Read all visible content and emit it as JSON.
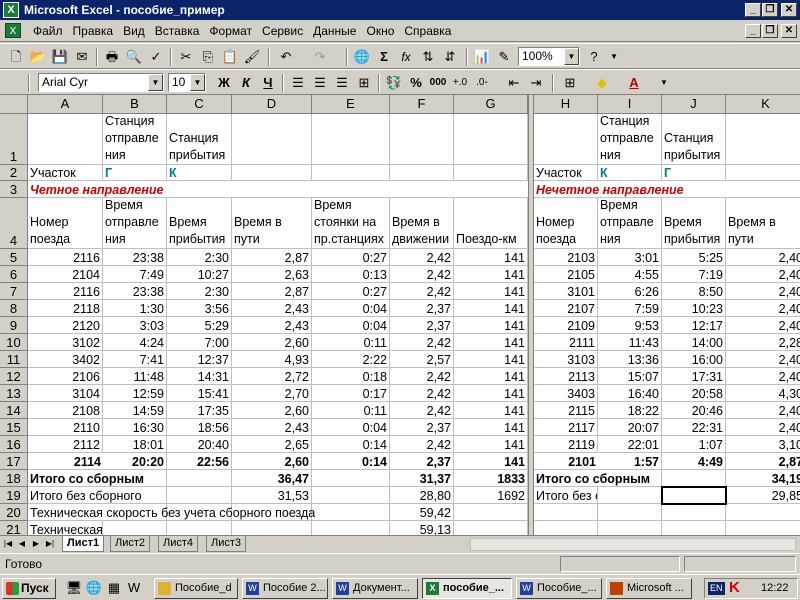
{
  "window": {
    "title": "Microsoft Excel - пособие_пример",
    "app_icon": "excel-icon"
  },
  "menu": [
    "Файл",
    "Правка",
    "Вид",
    "Вставка",
    "Формат",
    "Сервис",
    "Данные",
    "Окно",
    "Справка"
  ],
  "toolbar": {
    "zoom": "100%",
    "font_name": "Arial Cyr",
    "font_size": "10",
    "bold": "Ж",
    "italic": "К",
    "underline": "Ч",
    "percent": "%",
    "thousands": "000",
    "sigma": "Σ",
    "fx": "fx"
  },
  "columns": [
    "A",
    "B",
    "C",
    "D",
    "E",
    "F",
    "G",
    "H",
    "I",
    "J",
    "K"
  ],
  "rows": {
    "r1": {
      "n": "1",
      "B": "Станция отправле ния",
      "C": "Станция прибытия",
      "I": "Станция отправле ния",
      "J": "Станция прибытия"
    },
    "r2": {
      "n": "2",
      "A": "Участок",
      "B": "Г",
      "C": "К",
      "H": "Участок",
      "I": "К",
      "J": "Г"
    },
    "r3": {
      "n": "3",
      "A": "Четное направление",
      "H": "Нечетное направление"
    },
    "r4": {
      "n": "4",
      "A": "Номер поезда",
      "B": "Время отправле ния",
      "C": "Время прибытия",
      "D": "Время в пути",
      "E": "Время стоянки на пр.станциях",
      "F": "Время в движении",
      "G": "Поездо-км",
      "H": "Номер поезда",
      "I": "Время отправле ния",
      "J": "Время прибытия",
      "K": "Время в пути"
    }
  },
  "data_rows": [
    {
      "n": "5",
      "A": "2116",
      "B": "23:38",
      "C": "2:30",
      "D": "2,87",
      "E": "0:27",
      "F": "2,42",
      "G": "141",
      "H": "2103",
      "I": "3:01",
      "J": "5:25",
      "K": "2,40"
    },
    {
      "n": "6",
      "A": "2104",
      "B": "7:49",
      "C": "10:27",
      "D": "2,63",
      "E": "0:13",
      "F": "2,42",
      "G": "141",
      "H": "2105",
      "I": "4:55",
      "J": "7:19",
      "K": "2,40"
    },
    {
      "n": "7",
      "A": "2116",
      "B": "23:38",
      "C": "2:30",
      "D": "2,87",
      "E": "0:27",
      "F": "2,42",
      "G": "141",
      "H": "3101",
      "I": "6:26",
      "J": "8:50",
      "K": "2,40"
    },
    {
      "n": "8",
      "A": "2118",
      "B": "1:30",
      "C": "3:56",
      "D": "2,43",
      "E": "0:04",
      "F": "2,37",
      "G": "141",
      "H": "2107",
      "I": "7:59",
      "J": "10:23",
      "K": "2,40"
    },
    {
      "n": "9",
      "A": "2120",
      "B": "3:03",
      "C": "5:29",
      "D": "2,43",
      "E": "0:04",
      "F": "2,37",
      "G": "141",
      "H": "2109",
      "I": "9:53",
      "J": "12:17",
      "K": "2,40"
    },
    {
      "n": "10",
      "A": "3102",
      "B": "4:24",
      "C": "7:00",
      "D": "2,60",
      "E": "0:11",
      "F": "2,42",
      "G": "141",
      "H": "2111",
      "I": "11:43",
      "J": "14:00",
      "K": "2,28"
    },
    {
      "n": "11",
      "A": "3402",
      "B": "7:41",
      "C": "12:37",
      "D": "4,93",
      "E": "2:22",
      "F": "2,57",
      "G": "141",
      "H": "3103",
      "I": "13:36",
      "J": "16:00",
      "K": "2,40"
    },
    {
      "n": "12",
      "A": "2106",
      "B": "11:48",
      "C": "14:31",
      "D": "2,72",
      "E": "0:18",
      "F": "2,42",
      "G": "141",
      "H": "2113",
      "I": "15:07",
      "J": "17:31",
      "K": "2,40"
    },
    {
      "n": "13",
      "A": "3104",
      "B": "12:59",
      "C": "15:41",
      "D": "2,70",
      "E": "0:17",
      "F": "2,42",
      "G": "141",
      "H": "3403",
      "I": "16:40",
      "J": "20:58",
      "K": "4,30"
    },
    {
      "n": "14",
      "A": "2108",
      "B": "14:59",
      "C": "17:35",
      "D": "2,60",
      "E": "0:11",
      "F": "2,42",
      "G": "141",
      "H": "2115",
      "I": "18:22",
      "J": "20:46",
      "K": "2,40"
    },
    {
      "n": "15",
      "A": "2110",
      "B": "16:30",
      "C": "18:56",
      "D": "2,43",
      "E": "0:04",
      "F": "2,37",
      "G": "141",
      "H": "2117",
      "I": "20:07",
      "J": "22:31",
      "K": "2,40"
    },
    {
      "n": "16",
      "A": "2112",
      "B": "18:01",
      "C": "20:40",
      "D": "2,65",
      "E": "0:14",
      "F": "2,42",
      "G": "141",
      "H": "2119",
      "I": "22:01",
      "J": "1:07",
      "K": "3,10"
    },
    {
      "n": "17",
      "A": "2114",
      "B": "20:20",
      "C": "22:56",
      "D": "2,60",
      "E": "0:14",
      "F": "2,37",
      "G": "141",
      "H": "2101",
      "I": "1:57",
      "J": "4:49",
      "K": "2,87"
    }
  ],
  "totals": [
    {
      "n": "18",
      "A": "Итого со сборным",
      "D": "36,47",
      "F": "31,37",
      "G": "1833",
      "H": "Итого со сборным",
      "K": "34,19"
    },
    {
      "n": "19",
      "A": "Итого без сборного",
      "D": "31,53",
      "F": "28,80",
      "G": "1692",
      "H": "Итого без сборного",
      "K": "29,85"
    }
  ],
  "notes": [
    {
      "n": "20",
      "A": "Техническая скорость без учета сборного поезда",
      "F": "59,42"
    },
    {
      "n": "21",
      "A": "Техническая скорость с учетом сборного поезда",
      "F": "59,13"
    }
  ],
  "sheets": [
    "Лист1",
    "Лист2",
    "Лист4",
    "Лист3"
  ],
  "status": "Готово",
  "taskbar": {
    "start": "Пуск",
    "tasks": [
      "Пособие_d",
      "Пособие 2...",
      "Документ...",
      "пособие_...",
      "Пособие_...",
      "Microsoft ..."
    ],
    "lang": "EN",
    "clock": "12:22"
  }
}
